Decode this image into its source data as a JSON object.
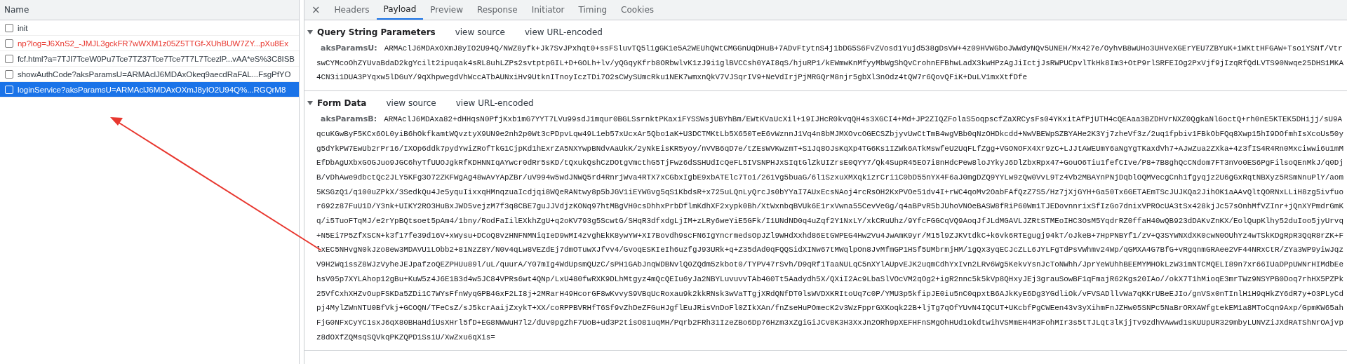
{
  "request_list": {
    "column": "Name",
    "requests": [
      {
        "name": "init",
        "failed": false,
        "selected": false
      },
      {
        "name": "np?log=J6XnS2_-JMJL3gckFR7wWXM1z05Z5TTGf-XUhBUW7ZY...pXu8Ex",
        "failed": true,
        "selected": false
      },
      {
        "name": "fcf.html?a=7TJI7TceW0Pu7Tce7TZ37Tce7Tce7T7L7TcezlP...vAA*eS%3C8ISB",
        "failed": false,
        "selected": false
      },
      {
        "name": "showAuthCode?aksParamsU=ARMAclJ6MDAxOkeq9aecdRaFAL...FsgPfYO",
        "failed": false,
        "selected": false
      },
      {
        "name": "loginService?aksParamsU=ARMAclJ6MDAxOXmJ8yIO2U94Q%...RGQrM8",
        "failed": false,
        "selected": true
      }
    ]
  },
  "detail_tabs": {
    "close": "×",
    "tabs": [
      {
        "label": "Headers",
        "selected": false
      },
      {
        "label": "Payload",
        "selected": true
      },
      {
        "label": "Preview",
        "selected": false
      },
      {
        "label": "Response",
        "selected": false
      },
      {
        "label": "Initiator",
        "selected": false
      },
      {
        "label": "Timing",
        "selected": false
      },
      {
        "label": "Cookies",
        "selected": false
      }
    ]
  },
  "sections": [
    {
      "title": "Query String Parameters",
      "expanded": true,
      "actions": [
        "view source",
        "view URL-encoded"
      ],
      "params": [
        {
          "name": "aksParamsU:",
          "value": "ARMAclJ6MDAxOXmJ8yIO2U94Q/NWZ8yfk+Jk7SvJPxhqt0+ssFSluvTQ5l1gGK1e5A2WEUhQWtCMGGnUqDHuB+7ADvFtytnS4j1bDG5S6FvZVosd1Yujd538gDsVW+4z09HVWGboJWWdyNQv5UNEH/Mx427e/OyhvB8wUHo3UHVeXGErYEU7ZBYuK+iWKttHFGAW+TsoiYSNf/VtrswCYMcoOhZYUvaBdaD2kgYcilt2ipuqak4sRL8uhLZPs2svtptpGIL+D+GOLh+lv/yQGqyKfrb8ORbwlvK1zJ9i1glBVCCsh0YAI8qS/hjuRP1/kEWmwKnMfyyMbWgShQvCrohnEFBhwLadX3kwHPzAgJiIctjJsRWPUCpvlTkHk8Im3+OtP9rlSRFEIOg2PxVjf9jIzqRfQdLVTS90Nwqe25DHS1MKA4CN3i1DUA3PYqxw5lDGuY/9qXhpwegdVhWccATbAUNxiHv9UtknITnoyIczTDi7O2sCWySUmcRku1NEK7wmxnQkV7VJSqrIV9+NeVdIrjPjMRGQrM8njr5gbXl3nOdz4tQW7r6QovQFiK+DuLV1mxXtfDfe"
        }
      ]
    },
    {
      "title": "Form Data",
      "expanded": true,
      "actions": [
        "view source",
        "view URL-encoded"
      ],
      "params": [
        {
          "name": "aksParamsB:",
          "value": "ARMAclJ6MDAxa82+dHHqsN0PfjKxb1mG7YYT7LVu99sdJ1mqur0BGLSsrnktPKaxiFYSSWsjUBYhBm/EWtKVaUcXil+19IJHcR0kvqQH4s3XGCI4+Md+JP2ZIQZFolaS5oqpscfZaXRCysFs04YKxitAfPjUTH4cQEAaa3BZDHVrNXZ0QgkaNl6octQ+rh0nE5KTEK5DHijj/sU9AqcuKGwByF5KCx6OL0yiB6hOkfkamtWQvztyX9UN9e2nh2p0Wt3cPDpvLqw49L1eb57xUcxAr5Qbo1aK+U3DCTMKtLb5X650TeE6vWznnJ1Vq4n8bMJMXOvcOGECSZbjyvUwCtTmB4wgVBb0qNzOHDkcdd+NwVBEWpSZBYAHe2K3Yj7zheVf3z/2uq1fpbiv1FBkObFQq8Xwp15hI9DOfmhIsXcoUs50yg5dYkPW7EwUb2rPr16/IXOp6ddk7pydYwiZRofTkG1CjpKd1hExrZA5NXYwpBNdvAaUkK/2yNkEisKR5yoy/nVVB6qD7e/tZEsWVKwzmT+S1Jq8OJsKqXp4TG6Ks1IZWk6ATkMswfeU2UqFLfZgg+VGONOFX4Xr9zC+LJJtAWEUmY6aNgYgTKaxdVh7+AJwZua2ZXka+4z3fIS4R4Rn0Mxciwwi6u1mMEfDbAgUXbxGOGJuo9JGC6hyTfUUOJgkRfKDHNNIqAYwcr0dRr5sKD/tQxukQshCzDOtgVmcthG5TjFwz6dSSHUdIcQeFL5IVSNPHJxSIqtGlZkUIZrsE0QYY7/Qk4SupR45EO7i8nHdcPew8loJYkyJ6DlZbxRpx47+GouO6Tiu1fefCIve/P8+7B8ghQcCNdom7FT3nVo0ES6PgFilsoQEnMkJ/q0DjB/vDhAwe9dbctQc2JLY5KFg3O72ZKFWgAg48wAvYApZBr/uV994w5wdJNWQ5rd4RnrjWva4RTX7xCGbxIgbE9xbATElc7Toi/261Vg5buaG/6l1SzxuXMXqkizrCri1C0bD55nYX4F6aJ0mgDZQ9YYLw9zQw0VvL9Tz4Vb2MBAYnPNjDqblOQMVecgCnh1fgyqjz2U6gGxRqtNBXyz5RSmNnuPlY/aom5KSGzQ1/q100uZPkX/3SedkQu4Je5yquIixxqHMnqzuaIcdjqi8WQeRANtwy8p5bJGV1iEYWGvg5qS1KbdsR+x725uLQnLyQrcJs0bYYaI7AUxEcsNAoj4rcRsOH2KxPVOe51dv4I+rWC4qoMv2OabFAfQzZ7S5/Hz7jXjGYH+Ga50Tx6GETAEmTScJUJKQa2JihOK1aAAvQltQORNxLLiH8zg5ivfuor692z87FuU1D/Y3nk+UIKY2RO3HuBxJWD5vejzM7f3q8CBE7guJJVdjzKONq97htMBgVH0csDhhxPrbDflmKdhXF2xypk0Bh/XtWxnbqBVUk6E1rxVwna55CevVeGg/q4aBPvR5bJUhoVNOeBASW8fRiP60Wm1TJEDovnnrixSfIzGo7dnixVPROcUA3tSx428kjJc57sOnhMfVZInr+jQnXYPmdrGmKq/i5TuoFTqMJ/e2rYpBQtsoet5pAm4/1bny/RodFaIilEXkhZgU+q2oKV793g5ScwtG/SHqR3dfxdgLjIM+zLRy6weYiE5GFk/I1UNdND0q4uZqf2Y1NxLY/xkCRuUhz/9YfcFGGCqVQ9AoqJfJLdMGAVLJZRtSTMEoIHC3OsM5YqdrRZ0ffaH40wQB923dDAKvZnKX/EolQupKlhy52duIoo5jyUrvq+N5Ei7P5ZfXSCN+k3f17fe39d16V+xWysu+DCoQ8vzHNFNMNiqIeD9wMI4zvghEkK8ywYW+XI7Bovdh9scFN6IgYncrmedsOpJZl9WHdXxhd86EtGWPEG4Hw2Vu4JwAmK9yr/M15l9ZJKVtdkC+k6vk6RTEgugj94kT/oJkeB+7HpPNBYf1/zV+Q3SYWNXdXK0cwN0OUhYz4wTSkKDgRpR3QqR8rZK+FlxEC5NHvgN0kJzo8ew3MDAVU1LObb2+81NzZ8Y/N0v4qLw8VEZdEj7dmOTuwXJfvv4/GvoqESKIeIh6uzfgJ93URk+q+Z35dAd0qFQQSidXINw67tMWqlpOn8JvMfmGP1HSf5UMbrmjHM/1gQx3yqECJcZLL6JYLFgTdPsVWhmv24Wp/qGMXA4G7BfG+vRgqnmGRAee2VF44NRxCtR/ZYa3WP9yiwJqzV9H2WqissZ8WJzVyheJEJpafzoQEZPHUu89l/uL/quurA/Y07mIg4WdUpsmQUzC/sPH1GAbJnqWDBNvlQ0ZQdm5zkbot0/TYPV47rSvh/D9qRf1TaaNULqC5nXYlAUpvEJK2uqmCdhYxIvn2LRv6Wg5KekvYsnJcToNWhh/JprYeWUhhBEEMYMHOkLzW3imNTCMQELI89n7xr66IUaDPpUWNrHIMdbEehsV05p7XYLAhop12gBu+KuW5z4J6E1B3d4w5JC84VPRs6wt4QNp/LxU480fwRXK9DLhMtgyz4mQcQEIu6yJa2NBYLuvuvvTAb4G0Tt5Aadydh5X/QXiI2Ac9LbaSlVOcVM2qOg2+igR2nnc5k5kVp8QHxyJEj3grauSowBF1qFmajR62Kgs20IAo//okX7T1hMioqE3mrTWz9NSYPB0Doq7rhHX5PZPk25VfCxhXHZvOupFSKDa5ZDi1C7WYsFfnWyqGPB4GxF2LI8j+2MRarH49HcorGF8wKvvyS9VBqUcRoxau9k2kkRNsk3wVaTTgjXRdQNfDT0lsWVDXKRItoUq7c0P/YMU3p5kfipJE0iu5nC0qpxtB6AJkKyE6Dg3YGdliOk/vFVSADllvWa7qKKrUBeEJIo/gnVSx0nTInlH1H9qHkZY6dR7y+O3PLyCdpj4MylZWnNTU0BfVkj+GCOQN/TFeCsZ/sJ5kcrAaijZxykT+XX/coRPPBVRHfT6Sf9vZhDeZFGuHJgflEuJRisVnDoFl0ZIkXAn/fnZseHuPOmecK2v3WzFpprGXKoqk22B+ljTg7qOfYUvN4IQCUT+UKcbfPgCWEen43v3yXihmFnJZHw05SNPc5NaBrORXAWfgtekEM1a8MToCqn9Axp/GpmKW65ahFjG0NFxCyYC1sxJ6qX80BHaHdiUsXHrl5fD+EG8NWWuH7l2/dUv0pgZhF7UoB+ud3P2tisO81uqMH/Pqrb2FRh31IzeZBo6Dp76Hzm3xZgiGiJCv8K3H3XxJn2ORh9pXEFHFnSMgOhHUd1okdtwihVSMmEH4M3FohMIr3s5tTJLqt3lKjjTv9zdhVAwwd1sKUUpUR329mbyLUNVZiJXdRATShNrOAjvpz8dOXfZQMsqSQVkqPKZQPD1SsiU/XwZxu6qXis="
        }
      ]
    }
  ]
}
